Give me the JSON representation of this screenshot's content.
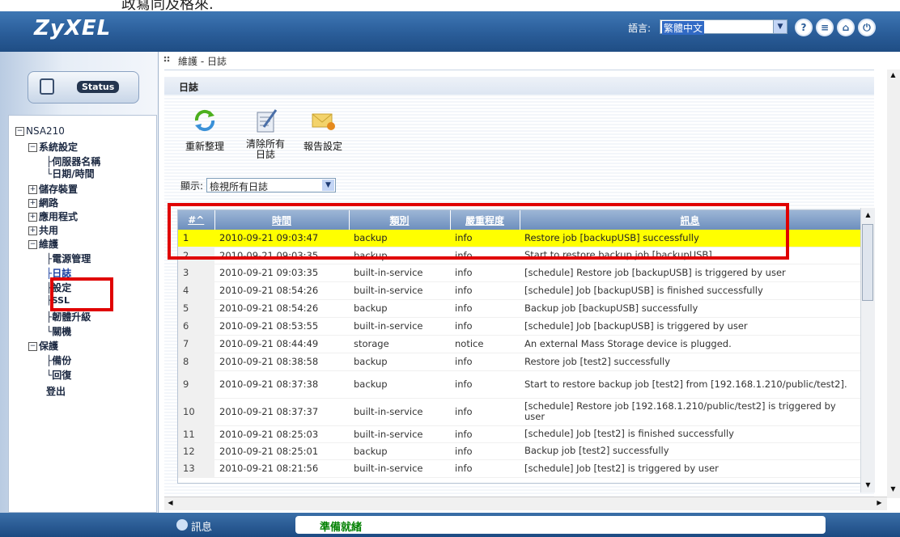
{
  "top_caption": "政寫同及格來.",
  "header": {
    "logo": "ZyXEL",
    "language_label": "語言:",
    "language_value": "繁體中文",
    "icons": [
      "help-icon",
      "doc-icon",
      "home-icon",
      "logout-icon"
    ]
  },
  "sidebar": {
    "status_label": "Status",
    "tree": {
      "root": "NSA210",
      "system": "系統設定",
      "server_name": "伺服器名稱",
      "datetime": "日期/時間",
      "storage": "儲存裝置",
      "network": "網路",
      "apps": "應用程式",
      "share": "共用",
      "maintenance": "維護",
      "power": "電源管理",
      "log": "日誌",
      "config": "設定",
      "ssl": "SSL",
      "firmware": "韌體升級",
      "shutdown": "關機",
      "protect": "保護",
      "backup": "備份",
      "restore": "回復",
      "logout": "登出"
    }
  },
  "breadcrumb": "維護 - 日誌",
  "panel": {
    "title": "日誌",
    "toolbar": {
      "refresh": "重新整理",
      "clear": "清除所有日誌",
      "report": "報告設定"
    },
    "show_label": "顯示:",
    "show_value": "檢視所有日誌"
  },
  "table": {
    "headers": [
      "#^",
      "時間",
      "類別",
      "嚴重程度",
      "訊息"
    ],
    "rows": [
      [
        "1",
        "2010-09-21 09:03:47",
        "backup",
        "info",
        "Restore job [backupUSB] successfully"
      ],
      [
        "2",
        "2010-09-21 09:03:35",
        "backup",
        "info",
        "Start to restore backup job [backupUSB]."
      ],
      [
        "3",
        "2010-09-21 09:03:35",
        "built-in-service",
        "info",
        "[schedule] Restore job [backupUSB] is triggered by user"
      ],
      [
        "4",
        "2010-09-21 08:54:26",
        "built-in-service",
        "info",
        "[schedule] Job [backupUSB] is finished successfully"
      ],
      [
        "5",
        "2010-09-21 08:54:26",
        "backup",
        "info",
        "Backup job [backupUSB] successfully"
      ],
      [
        "6",
        "2010-09-21 08:53:55",
        "built-in-service",
        "info",
        "[schedule] Job [backupUSB] is triggered by user"
      ],
      [
        "7",
        "2010-09-21 08:44:49",
        "storage",
        "notice",
        "An external Mass Storage device is plugged."
      ],
      [
        "8",
        "2010-09-21 08:38:58",
        "backup",
        "info",
        "Restore job [test2] successfully"
      ],
      [
        "9",
        "2010-09-21 08:37:38",
        "backup",
        "info",
        "Start to restore backup job [test2] from [192.168.1.210/public/test2]."
      ],
      [
        "10",
        "2010-09-21 08:37:37",
        "built-in-service",
        "info",
        "[schedule] Restore job [192.168.1.210/public/test2] is triggered by user"
      ],
      [
        "11",
        "2010-09-21 08:25:03",
        "built-in-service",
        "info",
        "[schedule] Job [test2] is finished successfully"
      ],
      [
        "12",
        "2010-09-21 08:25:01",
        "backup",
        "info",
        "Backup job [test2] successfully"
      ],
      [
        "13",
        "2010-09-21 08:21:56",
        "built-in-service",
        "info",
        "[schedule] Job [test2] is triggered by user"
      ]
    ],
    "highlight_color": "#ffff00"
  },
  "footer": {
    "label": "訊息",
    "status": "準備就緒"
  },
  "accent": "#e00000"
}
